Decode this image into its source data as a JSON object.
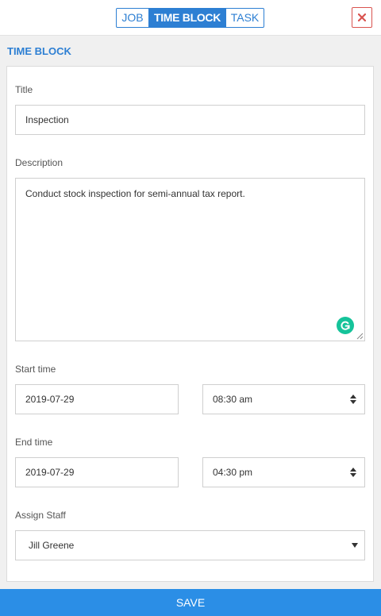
{
  "header": {
    "tabs": [
      {
        "label": "JOB",
        "active": false
      },
      {
        "label": "TIME BLOCK",
        "active": true
      },
      {
        "label": "TASK",
        "active": false
      }
    ],
    "close_icon": "close-x-icon",
    "close_color": "#d9534f"
  },
  "form": {
    "section_title": "TIME BLOCK",
    "title_label": "Title",
    "title_value": "Inspection",
    "description_label": "Description",
    "description_value": "Conduct stock inspection for semi-annual tax report.",
    "start_label": "Start time",
    "start_date": "2019-07-29",
    "start_time": "08:30 am",
    "end_label": "End time",
    "end_date": "2019-07-29",
    "end_time": "04:30 pm",
    "staff_label": "Assign Staff",
    "staff_value": "Jill Greene"
  },
  "footer": {
    "save_label": "SAVE"
  },
  "colors": {
    "accent": "#2d7fd3",
    "save_button": "#2b8ee6",
    "grammarly": "#15c39a"
  }
}
